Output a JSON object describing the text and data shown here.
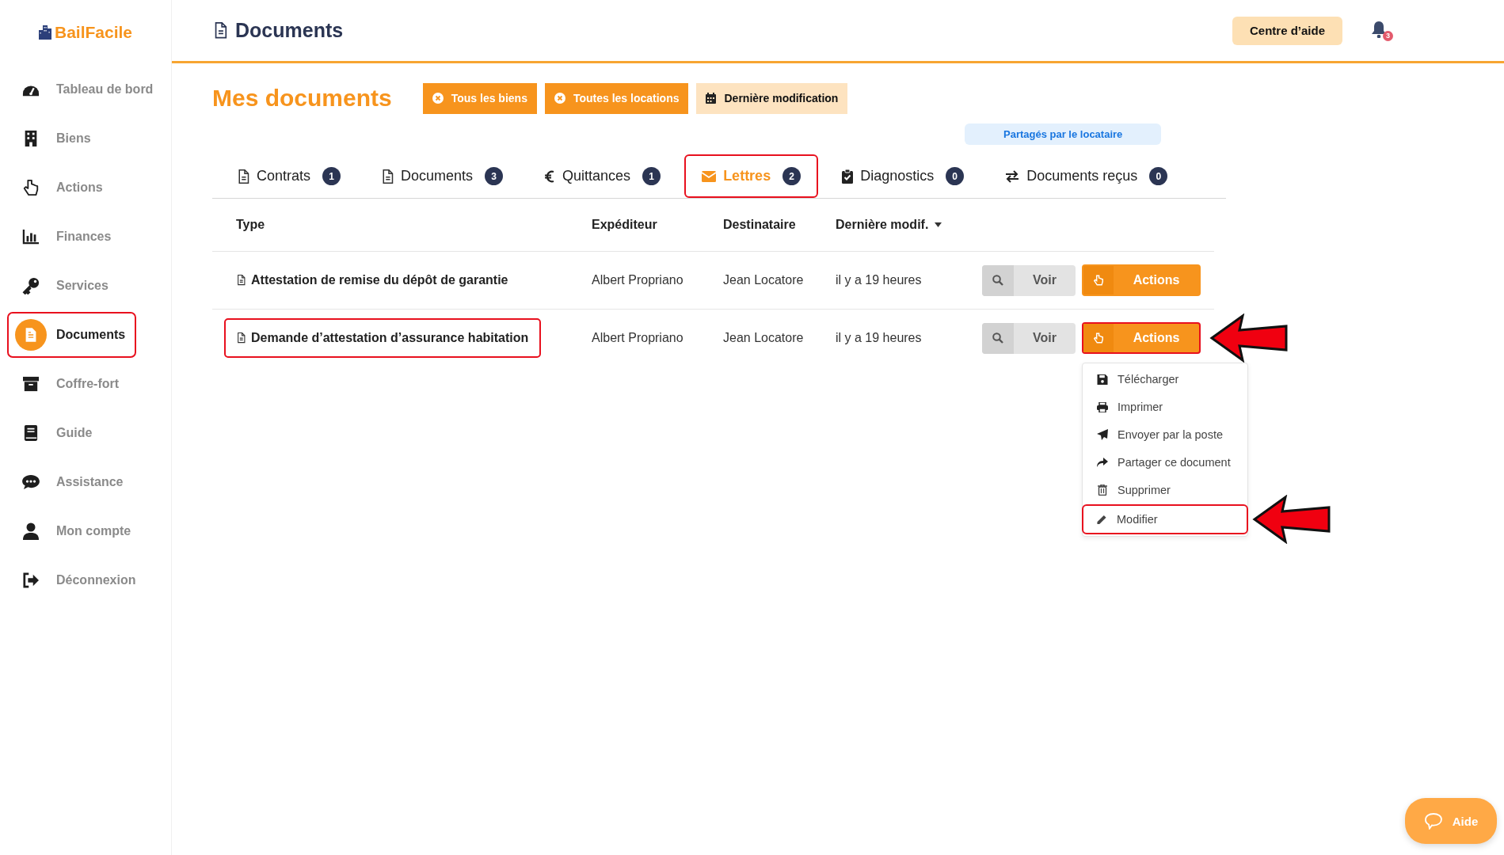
{
  "brand": {
    "name": "BailFacile"
  },
  "sidebar": {
    "items": [
      {
        "label": "Tableau de bord",
        "selected": false,
        "annotated": false
      },
      {
        "label": "Biens",
        "selected": false,
        "annotated": false
      },
      {
        "label": "Actions",
        "selected": false,
        "annotated": false
      },
      {
        "label": "Finances",
        "selected": false,
        "annotated": false
      },
      {
        "label": "Services",
        "selected": false,
        "annotated": false
      },
      {
        "label": "Documents",
        "selected": true,
        "annotated": true
      },
      {
        "label": "Coffre-fort",
        "selected": false,
        "annotated": false
      },
      {
        "label": "Guide",
        "selected": false,
        "annotated": false
      },
      {
        "label": "Assistance",
        "selected": false,
        "annotated": false
      },
      {
        "label": "Mon compte",
        "selected": false,
        "annotated": false
      },
      {
        "label": "Déconnexion",
        "selected": false,
        "annotated": false
      }
    ]
  },
  "header": {
    "title": "Documents",
    "help_button": "Centre d’aide",
    "notification_count": "3"
  },
  "page": {
    "title": "Mes documents",
    "filters": [
      {
        "label": "Tous les biens",
        "kind": "clear"
      },
      {
        "label": "Toutes les locations",
        "kind": "clear"
      },
      {
        "label": "Dernière modification",
        "kind": "sort"
      }
    ],
    "shared_link": "Partagés par le locataire"
  },
  "tabs": [
    {
      "label": "Contrats",
      "count": "1",
      "selected": false,
      "annotated": false
    },
    {
      "label": "Documents",
      "count": "3",
      "selected": false,
      "annotated": false
    },
    {
      "label": "Quittances",
      "count": "1",
      "selected": false,
      "annotated": false
    },
    {
      "label": "Lettres",
      "count": "2",
      "selected": true,
      "annotated": true
    },
    {
      "label": "Diagnostics",
      "count": "0",
      "selected": false,
      "annotated": false
    },
    {
      "label": "Documents reçus",
      "count": "0",
      "selected": false,
      "annotated": false
    }
  ],
  "table": {
    "columns": [
      {
        "label": "Type",
        "sorted": false
      },
      {
        "label": "Expéditeur",
        "sorted": false
      },
      {
        "label": "Destinataire",
        "sorted": false
      },
      {
        "label": "Dernière modif.",
        "sorted": true
      }
    ],
    "rows": [
      {
        "type": "Attestation de remise du dépôt de garantie",
        "sender": "Albert Propriano",
        "recipient": "Jean Locatore",
        "modified": "il y a 19 heures",
        "view_button": "Voir",
        "actions_button": "Actions",
        "annotated": false,
        "actions_annotated": false
      },
      {
        "type": "Demande d’attestation d’assurance habitation",
        "sender": "Albert Propriano",
        "recipient": "Jean Locatore",
        "modified": "il y a 19 heures",
        "view_button": "Voir",
        "actions_button": "Actions",
        "annotated": true,
        "actions_annotated": true,
        "menu": {
          "items": [
            {
              "label": "Télécharger",
              "annotated": false
            },
            {
              "label": "Imprimer",
              "annotated": false
            },
            {
              "label": "Envoyer par la poste",
              "annotated": false
            },
            {
              "label": "Partager ce document",
              "annotated": false
            },
            {
              "label": "Supprimer",
              "annotated": false
            },
            {
              "label": "Modifier",
              "annotated": true
            }
          ]
        }
      }
    ]
  },
  "help_widget": {
    "label": "Aide"
  }
}
